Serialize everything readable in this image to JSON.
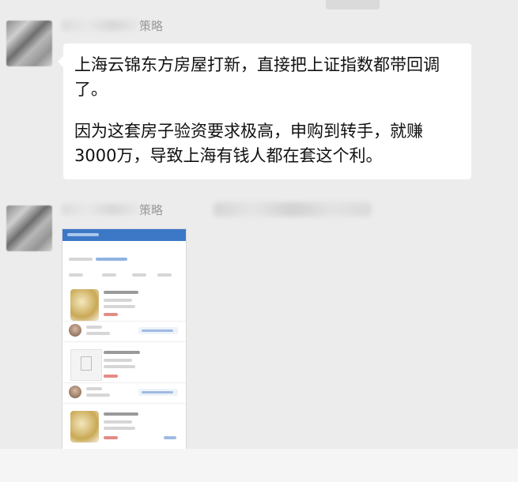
{
  "messages": [
    {
      "sender_suffix": "策略",
      "paragraphs": [
        "上海云锦东方房屋打新，直接把上证指数都带回调了。",
        "因为这套房子验资要求极高，申购到转手，就赚3000万，导致上海有钱人都在套这个利。"
      ]
    },
    {
      "sender_suffix": "策略"
    }
  ],
  "icons": {
    "avatar": "avatar-image",
    "attachment": "screenshot-thumbnail"
  }
}
